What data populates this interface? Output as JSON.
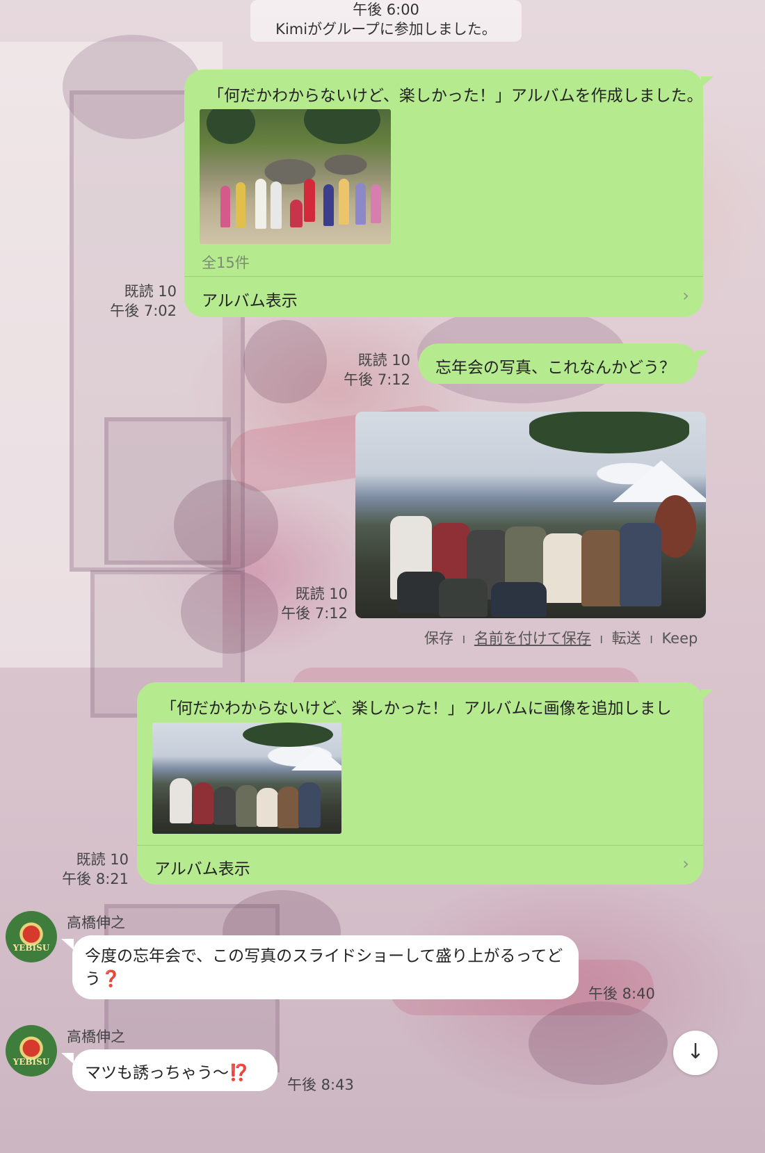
{
  "system": {
    "time": "午後 6:00",
    "notice": "Kimiがグループに参加しました。"
  },
  "messages": [
    {
      "album_title": "「何だかわからないけど、楽しかった！」アルバムを作成しました。",
      "count": "全15件",
      "link": "アルバム表示",
      "read": "既読 10",
      "time": "午後 7:02"
    },
    {
      "text": "忘年会の写真、これなんかどう？",
      "read": "既読 10",
      "time": "午後 7:12"
    },
    {
      "read": "既読 10",
      "time": "午後 7:12",
      "actions": {
        "save": "保存",
        "sep1": "I",
        "save_as": "名前を付けて保存",
        "sep2": "I",
        "forward": "転送",
        "sep3": "I",
        "keep": "Keep"
      }
    },
    {
      "album_title": "「何だかわからないけど、楽しかった！」アルバムに画像を追加しました。",
      "link": "アルバム表示",
      "read": "既読 10",
      "time": "午後 8:21"
    },
    {
      "sender": "高橋伸之",
      "text": "今度の忘年会で、この写真のスライドショーして盛り上がるってどう",
      "emoji": "❓",
      "time": "午後 8:40"
    },
    {
      "sender": "高橋伸之",
      "text": "マツも誘っちゃう〜",
      "emoji": "⁉️",
      "time": "午後 8:43"
    }
  ],
  "avatar": {
    "label": "YEBISU"
  },
  "icons": {
    "chevron": "›",
    "scroll_down": "↓"
  }
}
